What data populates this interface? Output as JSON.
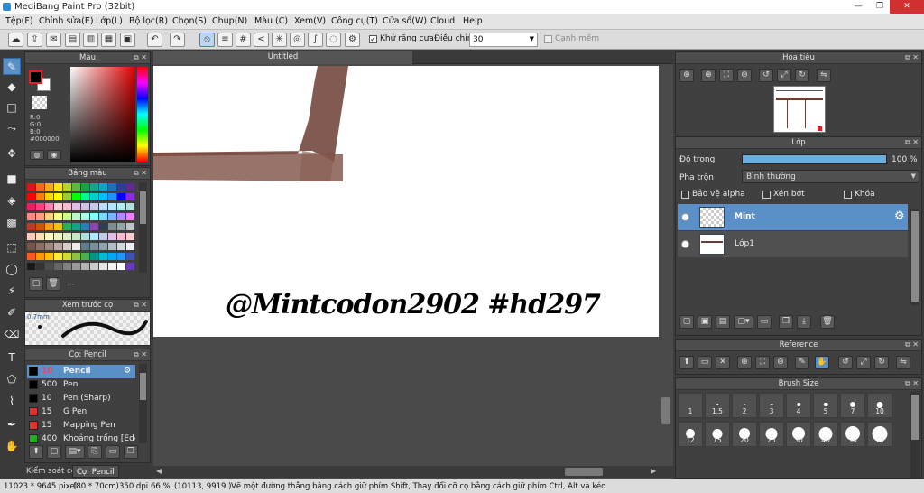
{
  "window": {
    "title": "MediBang Paint Pro (32bit)",
    "min": "—",
    "max": "❐",
    "close": "✕"
  },
  "menu": [
    "Tệp(F)",
    "Chỉnh sửa(E)",
    "Lớp(L)",
    "Bộ lọc(R)",
    "Chọn(S)",
    "Chụp(N)",
    "Màu (C)",
    "Xem(V)",
    "Công cụ(T)",
    "Cửa sổ(W)",
    "Cloud",
    "Help"
  ],
  "toolbar": {
    "antialias_label": "Khử răng cưa",
    "adjust_label": "Điều chỉnh",
    "adjust_value": "30",
    "soft_edge_label": "Cạnh mềm"
  },
  "color_panel": {
    "title": "Màu",
    "r": "R:0",
    "g": "G:0",
    "b": "B:0",
    "hex": "#000000",
    "primary": "#000000",
    "secondary": "#ffffff"
  },
  "palette_panel": {
    "title": "Bảng màu",
    "more": "---"
  },
  "preview_panel": {
    "title": "Xem trước cọ",
    "size": "0.7mm"
  },
  "brush_panel": {
    "title": "Cọ: Pencil",
    "items": [
      {
        "size": "10",
        "name": "Pencil",
        "color": "#000000",
        "selected": true
      },
      {
        "size": "500",
        "name": "Pen",
        "color": "#000000",
        "selected": false
      },
      {
        "size": "10",
        "name": "Pen (Sharp)",
        "color": "#000000",
        "selected": false
      },
      {
        "size": "15",
        "name": "G Pen",
        "color": "#e03030",
        "selected": false
      },
      {
        "size": "15",
        "name": "Mapping Pen",
        "color": "#e03030",
        "selected": false
      },
      {
        "size": "400",
        "name": "Khoảng trống [Edge]",
        "color": "#22aa22",
        "selected": false
      }
    ],
    "tab1": "Kiểm soát cọ",
    "tab2": "Cọ: Pencil"
  },
  "canvas": {
    "tab": "Untitled",
    "handwriting": "@Mintcodon2902 #hd297"
  },
  "navigator": {
    "title": "Hoa tiêu"
  },
  "layers": {
    "title": "Lớp",
    "opacity_label": "Độ trong",
    "opacity_value": "100 %",
    "opacity": 1.0,
    "blend_label": "Pha trộn",
    "blend_value": "Bình thường",
    "protect_alpha": "Bảo vệ alpha",
    "clipping": "Xén bớt",
    "lock": "Khóa",
    "items": [
      {
        "name": "Mint",
        "selected": true
      },
      {
        "name": "Lớp1",
        "selected": false
      }
    ]
  },
  "reference": {
    "title": "Reference"
  },
  "brush_size": {
    "title": "Brush Size",
    "sizes": [
      "1",
      "1.5",
      "2",
      "3",
      "4",
      "5",
      "7",
      "10",
      "12",
      "15",
      "20",
      "25",
      "30",
      "40",
      "50",
      "70"
    ]
  },
  "status": {
    "size": "11023 * 9645 pixel",
    "cm": "(80 * 70cm)",
    "dpi": "350 dpi",
    "zoom": "66 %",
    "coords": "(10113, 9919 )",
    "hint": "Vẽ một đường thẳng bằng cách giữ phím Shift, Thay đổi cỡ cọ bằng cách giữ phím Ctrl, Alt và kéo"
  }
}
